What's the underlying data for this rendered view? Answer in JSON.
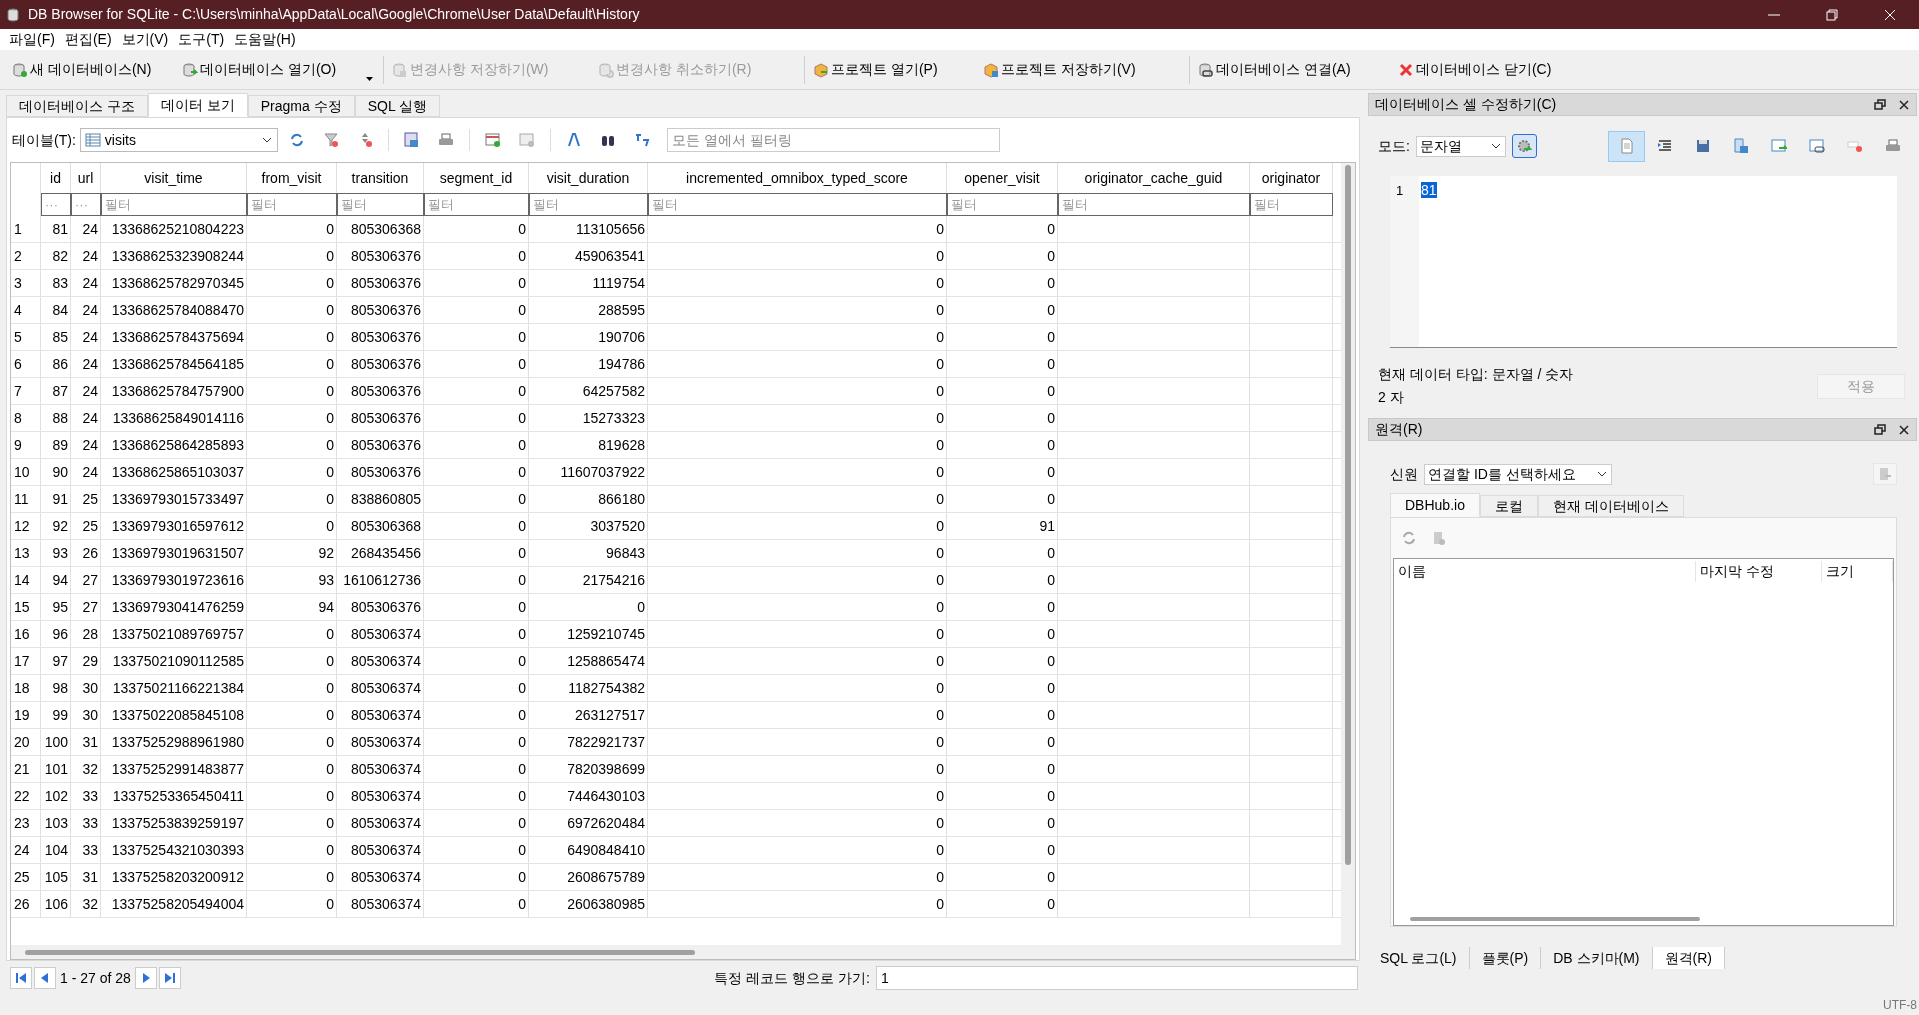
{
  "window": {
    "title": "DB Browser for SQLite - C:\\Users\\minha\\AppData\\Local\\Google\\Chrome\\User Data\\Default\\History"
  },
  "menu": [
    "파일(F)",
    "편집(E)",
    "보기(V)",
    "도구(T)",
    "도움말(H)"
  ],
  "toolbar": [
    {
      "kind": "new",
      "label": "새 데이터베이스(N)",
      "disabled": false
    },
    {
      "kind": "open",
      "label": "데이터베이스 열기(O)",
      "disabled": false
    },
    {
      "kind": "save",
      "label": "변경사항 저장하기(W)",
      "disabled": true
    },
    {
      "kind": "revert",
      "label": "변경사항 취소하기(R)",
      "disabled": true
    },
    {
      "kind": "project-open",
      "label": "프로젝트 열기(P)",
      "disabled": false
    },
    {
      "kind": "project-save",
      "label": "프로젝트 저장하기(V)",
      "disabled": false
    },
    {
      "kind": "attach",
      "label": "데이터베이스 연결(A)",
      "disabled": false
    },
    {
      "kind": "close",
      "label": "데이터베이스 닫기(C)",
      "disabled": false
    }
  ],
  "tabs": [
    {
      "label": "데이터베이스 구조",
      "selected": false
    },
    {
      "label": "데이터 보기",
      "selected": true
    },
    {
      "label": "Pragma 수정",
      "selected": false
    },
    {
      "label": "SQL 실행",
      "selected": false
    }
  ],
  "browse": {
    "table_label": "테이블(T):",
    "table_value": "visits",
    "filter_placeholder": "모든 열에서 필터링"
  },
  "grid": {
    "columns": [
      "id",
      "url",
      "visit_time",
      "from_visit",
      "transition",
      "segment_id",
      "visit_duration",
      "incremented_omnibox_typed_score",
      "opener_visit",
      "originator_cache_guid",
      "originator"
    ],
    "filter_placeholders": [
      "···",
      "···",
      "필터",
      "필터",
      "필터",
      "필터",
      "필터",
      "필터",
      "필터",
      "필터",
      "필터"
    ],
    "rows": [
      {
        "number": "1",
        "cells": [
          "81",
          "24",
          "13368625210804223",
          "0",
          "805306368",
          "0",
          "113105656",
          "0",
          "0"
        ]
      },
      {
        "number": "2",
        "cells": [
          "82",
          "24",
          "13368625323908244",
          "0",
          "805306376",
          "0",
          "459063541",
          "0",
          "0"
        ]
      },
      {
        "number": "3",
        "cells": [
          "83",
          "24",
          "13368625782970345",
          "0",
          "805306376",
          "0",
          "1119754",
          "0",
          "0"
        ]
      },
      {
        "number": "4",
        "cells": [
          "84",
          "24",
          "13368625784088470",
          "0",
          "805306376",
          "0",
          "288595",
          "0",
          "0"
        ]
      },
      {
        "number": "5",
        "cells": [
          "85",
          "24",
          "13368625784375694",
          "0",
          "805306376",
          "0",
          "190706",
          "0",
          "0"
        ]
      },
      {
        "number": "6",
        "cells": [
          "86",
          "24",
          "13368625784564185",
          "0",
          "805306376",
          "0",
          "194786",
          "0",
          "0"
        ]
      },
      {
        "number": "7",
        "cells": [
          "87",
          "24",
          "13368625784757900",
          "0",
          "805306376",
          "0",
          "64257582",
          "0",
          "0"
        ]
      },
      {
        "number": "8",
        "cells": [
          "88",
          "24",
          "13368625849014116",
          "0",
          "805306376",
          "0",
          "15273323",
          "0",
          "0"
        ]
      },
      {
        "number": "9",
        "cells": [
          "89",
          "24",
          "13368625864285893",
          "0",
          "805306376",
          "0",
          "819628",
          "0",
          "0"
        ]
      },
      {
        "number": "10",
        "cells": [
          "90",
          "24",
          "13368625865103037",
          "0",
          "805306376",
          "0",
          "11607037922",
          "0",
          "0"
        ]
      },
      {
        "number": "11",
        "cells": [
          "91",
          "25",
          "13369793015733497",
          "0",
          "838860805",
          "0",
          "866180",
          "0",
          "0"
        ]
      },
      {
        "number": "12",
        "cells": [
          "92",
          "25",
          "13369793016597612",
          "0",
          "805306368",
          "0",
          "3037520",
          "0",
          "91"
        ]
      },
      {
        "number": "13",
        "cells": [
          "93",
          "26",
          "13369793019631507",
          "92",
          "268435456",
          "0",
          "96843",
          "0",
          "0"
        ]
      },
      {
        "number": "14",
        "cells": [
          "94",
          "27",
          "13369793019723616",
          "93",
          "1610612736",
          "0",
          "21754216",
          "0",
          "0"
        ]
      },
      {
        "number": "15",
        "cells": [
          "95",
          "27",
          "13369793041476259",
          "94",
          "805306376",
          "0",
          "0",
          "0",
          "0"
        ]
      },
      {
        "number": "16",
        "cells": [
          "96",
          "28",
          "13375021089769757",
          "0",
          "805306374",
          "0",
          "1259210745",
          "0",
          "0"
        ]
      },
      {
        "number": "17",
        "cells": [
          "97",
          "29",
          "13375021090112585",
          "0",
          "805306374",
          "0",
          "1258865474",
          "0",
          "0"
        ]
      },
      {
        "number": "18",
        "cells": [
          "98",
          "30",
          "13375021166221384",
          "0",
          "805306374",
          "0",
          "1182754382",
          "0",
          "0"
        ]
      },
      {
        "number": "19",
        "cells": [
          "99",
          "30",
          "13375022085845108",
          "0",
          "805306374",
          "0",
          "263127517",
          "0",
          "0"
        ]
      },
      {
        "number": "20",
        "cells": [
          "100",
          "31",
          "13375252988961980",
          "0",
          "805306374",
          "0",
          "7822921737",
          "0",
          "0"
        ]
      },
      {
        "number": "21",
        "cells": [
          "101",
          "32",
          "13375252991483877",
          "0",
          "805306374",
          "0",
          "7820398699",
          "0",
          "0"
        ]
      },
      {
        "number": "22",
        "cells": [
          "102",
          "33",
          "13375253365450411",
          "0",
          "805306374",
          "0",
          "7446430103",
          "0",
          "0"
        ]
      },
      {
        "number": "23",
        "cells": [
          "103",
          "33",
          "13375253839259197",
          "0",
          "805306374",
          "0",
          "6972620484",
          "0",
          "0"
        ]
      },
      {
        "number": "24",
        "cells": [
          "104",
          "33",
          "13375254321030393",
          "0",
          "805306374",
          "0",
          "6490848410",
          "0",
          "0"
        ]
      },
      {
        "number": "25",
        "cells": [
          "105",
          "31",
          "13375258203200912",
          "0",
          "805306374",
          "0",
          "2608675789",
          "0",
          "0"
        ]
      },
      {
        "number": "26",
        "cells": [
          "106",
          "32",
          "13375258205494004",
          "0",
          "805306374",
          "0",
          "2606380985",
          "0",
          "0"
        ]
      }
    ]
  },
  "pager": {
    "range": "1 - 27 of 28",
    "goto_label": "특정 레코드 행으로 가기:",
    "goto_value": "1"
  },
  "cell_editor": {
    "title": "데이터베이스 셀 수정하기(C)",
    "mode_label": "모드:",
    "mode_value": "문자열",
    "line_number": "1",
    "content": "81",
    "type_text": "현재 데이터 타입: 문자열 / 숫자",
    "length": "2 자",
    "apply": "적용"
  },
  "remote": {
    "title": "원격(R)",
    "identity_label": "신원",
    "identity_value": "연결할 ID를 선택하세요",
    "tabs": [
      {
        "label": "DBHub.io",
        "selected": true
      },
      {
        "label": "로컬",
        "selected": false
      },
      {
        "label": "현재 데이터베이스",
        "selected": false
      }
    ],
    "columns": [
      "이름",
      "마지막 수정",
      "크기"
    ]
  },
  "dock_tabs": [
    {
      "label": "SQL 로그(L)",
      "selected": false
    },
    {
      "label": "플롯(P)",
      "selected": false
    },
    {
      "label": "DB 스키마(M)",
      "selected": false
    },
    {
      "label": "원격(R)",
      "selected": true
    }
  ],
  "status_bar": {
    "encoding": "UTF-8"
  }
}
